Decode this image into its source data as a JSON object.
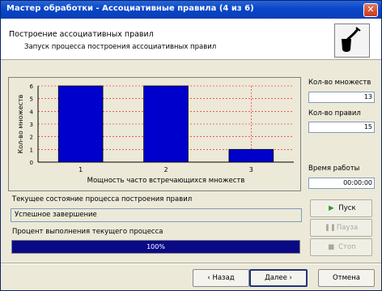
{
  "window": {
    "title": "Мастер обработки - Ассоциативные правила (4 из 6)"
  },
  "header": {
    "title": "Построение ассоциативных правил",
    "subtitle": "Запуск процесса построения ассоциативных правил"
  },
  "chart_data": {
    "type": "bar",
    "categories": [
      "1",
      "2",
      "3"
    ],
    "values": [
      6,
      6,
      1
    ],
    "xlabel": "Мощность часто встречающихся множеств",
    "ylabel": "Кол-во множеств",
    "ylim": [
      0,
      6
    ],
    "yticks": [
      "0",
      "1",
      "2",
      "3",
      "4",
      "5",
      "6"
    ],
    "grid": true,
    "bar_color": "#0000cc",
    "gridline_color": "#ff0000"
  },
  "stats": {
    "sets_label": "Кол-во множеств",
    "sets_value": "13",
    "rules_label": "Кол-во правил",
    "rules_value": "15",
    "time_label": "Время работы",
    "time_value": "00:00:00"
  },
  "status": {
    "state_label": "Текущее состояние процесса построения правил",
    "state_value": "Успешное завершение",
    "percent_label": "Процент выполнения текущего процесса",
    "progress_percent": 100,
    "progress_text": "100%"
  },
  "side_buttons": {
    "start": "Пуск",
    "pause": "Пауза",
    "stop": "Стоп",
    "start_icon": "play-icon",
    "pause_icon": "pause-icon",
    "stop_icon": "stop-icon"
  },
  "nav": {
    "back": "‹ Назад",
    "next": "Далее ›",
    "cancel": "Отмена"
  },
  "colors": {
    "titlebar": "#0846c9",
    "progress": "#0a0a87",
    "play": "#2a9a2a"
  }
}
